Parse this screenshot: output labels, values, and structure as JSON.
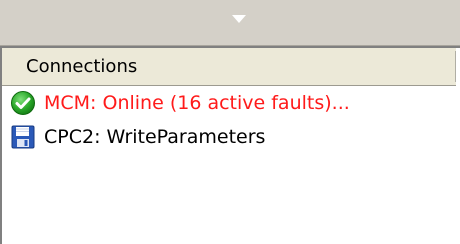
{
  "panel": {
    "header": "Connections"
  },
  "connections": [
    {
      "label": "MCM: Online (16 active faults)...",
      "icon": "check-circle-icon",
      "color": "#ff1a1a"
    },
    {
      "label": "CPC2: WriteParameters",
      "icon": "save-disk-icon",
      "color": "#000000"
    }
  ]
}
